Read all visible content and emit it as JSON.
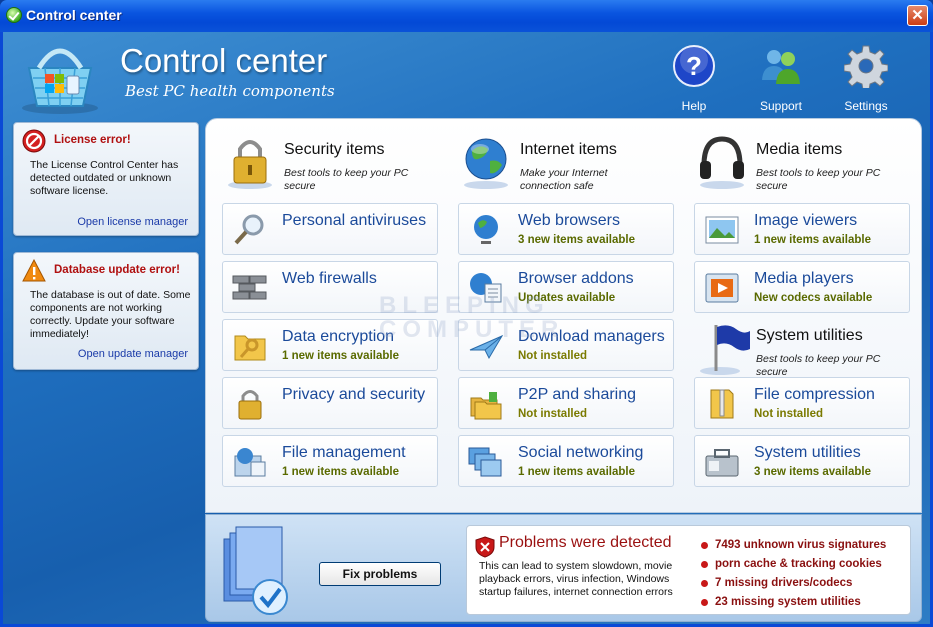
{
  "window": {
    "title": "Control center",
    "close": "✕"
  },
  "header": {
    "title": "Control center",
    "subtitle": "Best PC health components"
  },
  "topnav": [
    {
      "label": "Help"
    },
    {
      "label": "Support"
    },
    {
      "label": "Settings"
    }
  ],
  "sidebar": {
    "license": {
      "title": "License error!",
      "text": "The License Control Center has detected outdated or unknown software license.",
      "link": "Open license manager"
    },
    "database": {
      "title": "Database update error!",
      "text": "The database is out of date. Some components are not working correctly. Update your software immediately!",
      "link": "Open update manager"
    }
  },
  "columns": [
    {
      "title": "Security items",
      "subtitle": "Best tools to keep your PC secure"
    },
    {
      "title": "Internet items",
      "subtitle": "Make your Internet connection safe"
    },
    {
      "title": "Media items",
      "subtitle": "Best tools to keep your PC secure"
    }
  ],
  "security": [
    {
      "title": "Personal antiviruses",
      "status": ""
    },
    {
      "title": "Web firewalls",
      "status": ""
    },
    {
      "title": "Data encryption",
      "status": "1 new items available"
    },
    {
      "title": "Privacy and security",
      "status": ""
    },
    {
      "title": "File management",
      "status": "1 new items available"
    }
  ],
  "internet": [
    {
      "title": "Web browsers",
      "status": "3 new items available"
    },
    {
      "title": "Browser addons",
      "status": "Updates available"
    },
    {
      "title": "Download managers",
      "status": "Not installed"
    },
    {
      "title": "P2P and sharing",
      "status": "Not installed"
    },
    {
      "title": "Social networking",
      "status": "1 new items available"
    }
  ],
  "media": [
    {
      "title": "Image viewers",
      "status": "1 new items available"
    },
    {
      "title": "Media players",
      "status": "New codecs available"
    }
  ],
  "system_head": {
    "title": "System utilities",
    "subtitle": "Best tools to keep your PC secure"
  },
  "system": [
    {
      "title": "File compression",
      "status": "Not installed"
    },
    {
      "title": "System utilities",
      "status": "3 new items available"
    }
  ],
  "watermark": {
    "line1": "BLEEPING",
    "line2": "COMPUTER"
  },
  "bottom": {
    "fix_label": "Fix problems",
    "problems_title": "Problems were detected",
    "problems_text": "This can lead to system slowdown, movie playback errors, virus infection, Windows startup failures, internet connection errors",
    "issues": [
      "7493 unknown virus signatures",
      "porn cache & tracking cookies",
      "7 missing drivers/codecs",
      "23 missing system utilities"
    ]
  }
}
